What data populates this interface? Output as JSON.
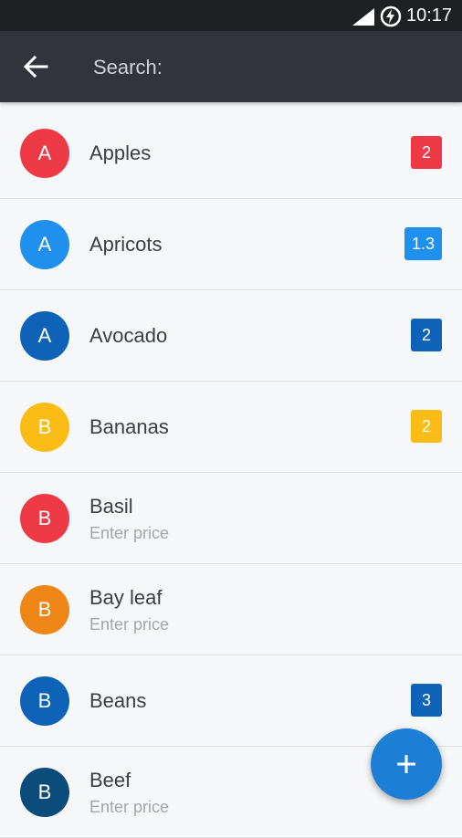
{
  "status_bar": {
    "time": "10:17"
  },
  "app_bar": {
    "search_placeholder": "Search:",
    "back_icon": "arrow-left-icon"
  },
  "items": [
    {
      "initial": "A",
      "name": "Apples",
      "avatar_color": "#ee3a46",
      "badge": "2",
      "badge_color": "#ee3a46"
    },
    {
      "initial": "A",
      "name": "Apricots",
      "avatar_color": "#1f90ee",
      "badge": "1.3",
      "badge_color": "#1f90ee"
    },
    {
      "initial": "A",
      "name": "Avocado",
      "avatar_color": "#0e63b8",
      "badge": "2",
      "badge_color": "#0e63b8"
    },
    {
      "initial": "B",
      "name": "Bananas",
      "avatar_color": "#fbbd15",
      "badge": "2",
      "badge_color": "#fbbd15"
    },
    {
      "initial": "B",
      "name": "Basil",
      "avatar_color": "#ee3a46",
      "hint": "Enter price"
    },
    {
      "initial": "B",
      "name": "Bay leaf",
      "avatar_color": "#ee8615",
      "hint": "Enter price"
    },
    {
      "initial": "B",
      "name": "Beans",
      "avatar_color": "#0e63b8",
      "badge": "3",
      "badge_color": "#0e63b8"
    },
    {
      "initial": "B",
      "name": "Beef",
      "avatar_color": "#0b4c7a",
      "hint": "Enter price"
    }
  ],
  "fab": {
    "icon": "plus-icon",
    "color": "#1d7ed6"
  }
}
